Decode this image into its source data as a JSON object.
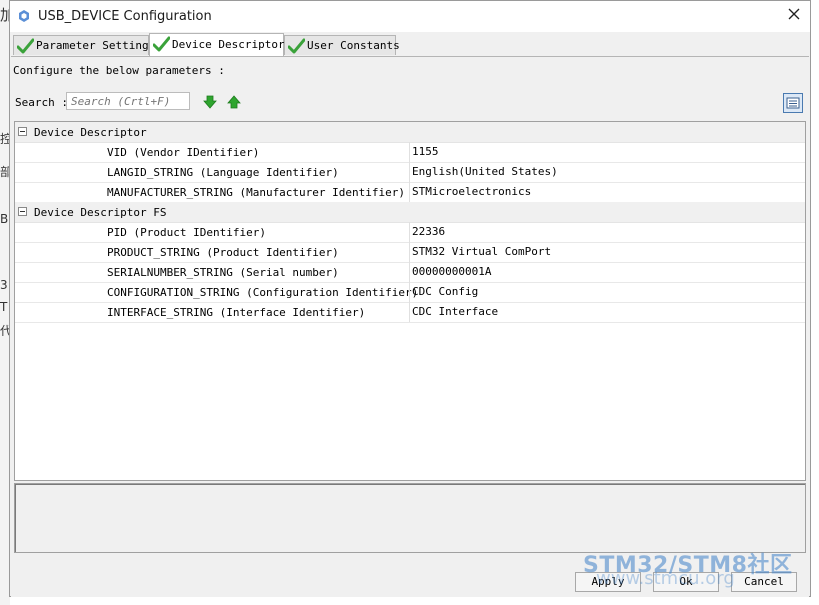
{
  "window": {
    "title": "USB_DEVICE Configuration"
  },
  "tabs": [
    {
      "label": "Parameter Settings",
      "active": false,
      "icon": "check-icon"
    },
    {
      "label": "Device Descriptor",
      "active": true,
      "icon": "check-icon"
    },
    {
      "label": "User Constants",
      "active": false,
      "icon": "check-icon"
    }
  ],
  "panel": {
    "instructions": "Configure the below parameters :",
    "search": {
      "label": "Search :",
      "placeholder": "Search (Crtl+F)",
      "value": ""
    }
  },
  "groups": [
    {
      "title": "Device Descriptor",
      "params": [
        {
          "name": "VID (Vendor IDentifier)",
          "value": "1155"
        },
        {
          "name": "LANGID_STRING (Language Identifier)",
          "value": "English(United States)"
        },
        {
          "name": "MANUFACTURER_STRING (Manufacturer Identifier)",
          "value": "STMicroelectronics"
        }
      ]
    },
    {
      "title": "Device Descriptor FS",
      "params": [
        {
          "name": "PID (Product IDentifier)",
          "value": "22336"
        },
        {
          "name": "PRODUCT_STRING (Product Identifier)",
          "value": "STM32 Virtual ComPort"
        },
        {
          "name": "SERIALNUMBER_STRING (Serial number)",
          "value": "00000000001A"
        },
        {
          "name": "CONFIGURATION_STRING (Configuration Identifier)",
          "value": "CDC Config"
        },
        {
          "name": "INTERFACE_STRING (Interface Identifier)",
          "value": "CDC Interface"
        }
      ]
    }
  ],
  "buttons": {
    "apply": "Apply",
    "ok": "Ok",
    "cancel": "Cancel"
  },
  "watermark": {
    "line1": "STM32/STM8社区",
    "line2": "www.stmcu.org"
  },
  "background": {
    "glyphs": [
      "加",
      "控",
      "部",
      "B",
      "3",
      "T",
      "代"
    ]
  },
  "colors": {
    "check": "#3aa23a",
    "arrow": "#2fa52f",
    "accent": "#4a7ab0"
  }
}
